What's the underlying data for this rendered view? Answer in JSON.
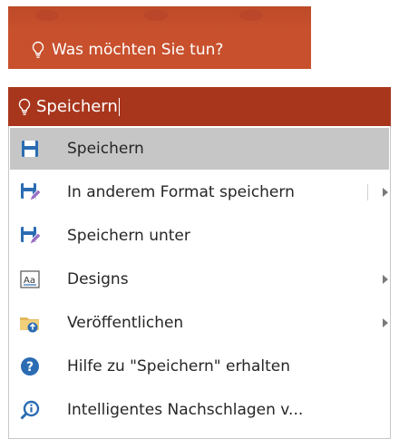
{
  "tell_me": {
    "placeholder": "Was möchten Sie tun?",
    "query": "Speichern"
  },
  "colors": {
    "bar_idle": "#c8502d",
    "bar_active": "#a8361d",
    "selected_row": "#c6c6c6",
    "icon_blue": "#2b6cb3"
  },
  "menu": {
    "items": [
      {
        "label": "Speichern",
        "icon": "save-icon"
      },
      {
        "label": "In anderem Format speichern",
        "icon": "save-as-format-icon"
      },
      {
        "label": "Speichern unter",
        "icon": "save-as-icon"
      },
      {
        "label": "Designs",
        "icon": "designs-icon"
      },
      {
        "label": "Veröffentlichen",
        "icon": "publish-folder-icon"
      },
      {
        "label": "Hilfe zu \"Speichern\" erhalten",
        "icon": "help-icon"
      },
      {
        "label": "Intelligentes Nachschlagen v...",
        "icon": "smart-lookup-icon"
      }
    ]
  }
}
